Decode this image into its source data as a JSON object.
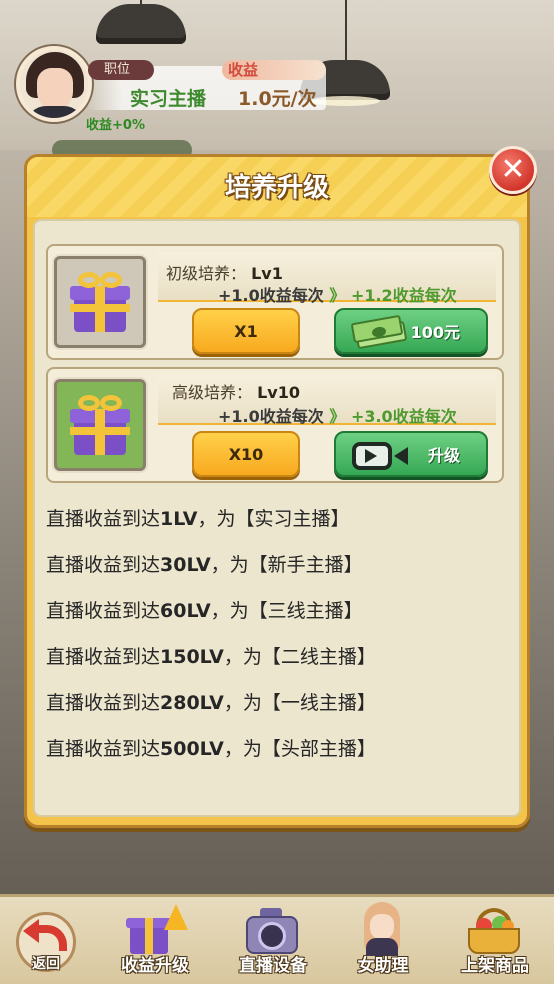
{
  "header": {
    "position_label": "职位",
    "income_label": "收益",
    "position_name": "实习主播",
    "income_rate": "1.0元/次",
    "bonus": "收益+0%"
  },
  "dialog": {
    "title": "培养升级",
    "close_icon": "close-icon",
    "cards": [
      {
        "name": "初级培养：",
        "level": "Lv1",
        "current_gain": "+1.0收益每次",
        "arrow": "》",
        "next_gain": "+1.2收益每次",
        "multiplier_label": "X1",
        "action_label": "100元",
        "action_icon": "cash-icon"
      },
      {
        "name": "高级培养：",
        "level": "Lv10",
        "current_gain": "+1.0收益每次",
        "arrow": "》",
        "next_gain": "+3.0收益每次",
        "multiplier_label": "X10",
        "action_label": "升级",
        "action_icon": "video-icon"
      }
    ],
    "rules": [
      {
        "prefix": "直播收益到达",
        "level": "1LV",
        "suffix": "，为【实习主播】"
      },
      {
        "prefix": "直播收益到达",
        "level": "30LV",
        "suffix": "，为【新手主播】"
      },
      {
        "prefix": "直播收益到达",
        "level": "60LV",
        "suffix": "，为【三线主播】"
      },
      {
        "prefix": "直播收益到达",
        "level": "150LV",
        "suffix": "，为【二线主播】"
      },
      {
        "prefix": "直播收益到达",
        "level": "280LV",
        "suffix": "，为【一线主播】"
      },
      {
        "prefix": "直播收益到达",
        "level": "500LV",
        "suffix": "，为【头部主播】"
      }
    ]
  },
  "bottom_nav": {
    "back_label": "返回",
    "items": [
      {
        "label": "收益升级",
        "icon": "gift-upgrade-icon"
      },
      {
        "label": "直播设备",
        "icon": "camera-icon"
      },
      {
        "label": "女助理",
        "icon": "assistant-icon"
      },
      {
        "label": "上架商品",
        "icon": "basket-icon"
      }
    ]
  },
  "colors": {
    "dialog_frame": "#f4c44a",
    "green_button": "#35a854",
    "yellow_button": "#f8a91f",
    "close_button": "#d2362b",
    "gain_green": "#4f9a2e"
  }
}
